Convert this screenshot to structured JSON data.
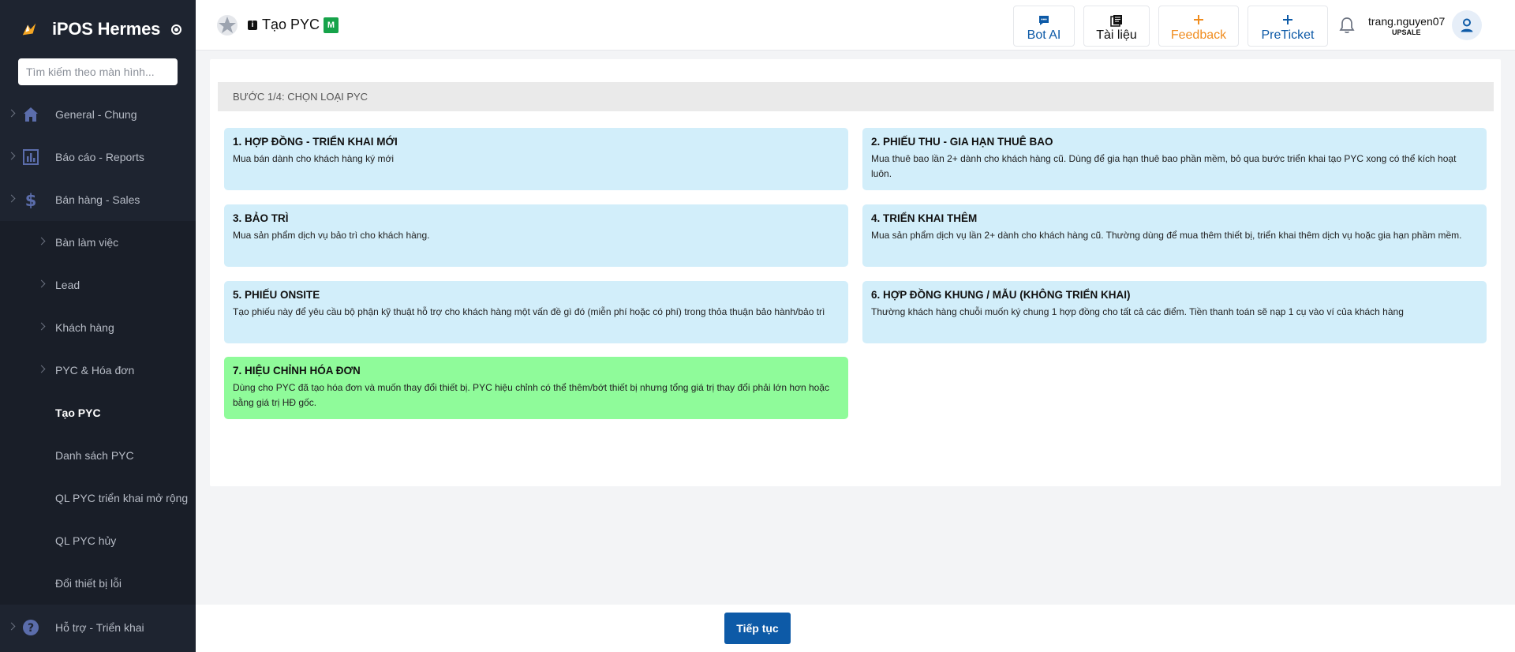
{
  "app": {
    "name": "iPOS Hermes",
    "search_placeholder": "Tìm kiếm theo màn hình..."
  },
  "sidebar": {
    "items": [
      {
        "label": "General - Chung",
        "icon": "home-icon"
      },
      {
        "label": "Báo cáo - Reports",
        "icon": "bar-chart-icon"
      },
      {
        "label": "Bán hàng - Sales",
        "icon": "dollar-icon"
      },
      {
        "label": "Bàn làm việc"
      },
      {
        "label": "Lead"
      },
      {
        "label": "Khách hàng"
      },
      {
        "label": "PYC & Hóa đơn"
      },
      {
        "label": "Tạo PYC"
      },
      {
        "label": "Danh sách PYC"
      },
      {
        "label": "QL PYC triển khai mở rộng"
      },
      {
        "label": "QL PYC hủy"
      },
      {
        "label": "Đổi thiết bị lỗi"
      },
      {
        "label": "Hỗ trợ - Triển khai",
        "icon": "help-icon"
      }
    ],
    "active_item": "Tạo PYC"
  },
  "header": {
    "info_glyph": "i",
    "title": "Tạo PYC",
    "badge": "M",
    "buttons": [
      {
        "label": "Bot AI",
        "icon": "chat-icon",
        "color": "#0d5aa7"
      },
      {
        "label": "Tài liệu",
        "icon": "book-icon",
        "color": "#111111"
      },
      {
        "label": "Feedback",
        "icon": "plus-icon",
        "color": "#f08c1e"
      },
      {
        "label": "PreTicket",
        "icon": "plus-icon",
        "color": "#0d5aa7"
      }
    ],
    "user": {
      "name": "trang.nguyen07",
      "role": "UPSALE"
    }
  },
  "main": {
    "step_label": "BƯỚC 1/4: CHỌN LOẠI PYC",
    "options": [
      {
        "title": "1. HỢP ĐỒNG - TRIỂN KHAI MỚI",
        "desc": "Mua bán dành cho khách hàng ký mới",
        "color": "#d2eefa"
      },
      {
        "title": "2. PHIẾU THU - GIA HẠN THUÊ BAO",
        "desc": "Mua thuê bao lần 2+ dành cho khách hàng cũ. Dùng để gia hạn thuê bao phần mềm, bỏ qua bước triển khai tạo PYC xong có thể kích hoạt luôn.",
        "color": "#d2eefa"
      },
      {
        "title": "3. BẢO TRÌ",
        "desc": "Mua sản phẩm dịch vụ bảo trì cho khách hàng.",
        "color": "#d2eefa"
      },
      {
        "title": "4. TRIỂN KHAI THÊM",
        "desc": "Mua sản phẩm dịch vụ lần 2+ dành cho khách hàng cũ. Thường dùng để mua thêm thiết bị, triển khai thêm dịch vụ hoặc gia hạn phầm mềm.",
        "color": "#d2eefa"
      },
      {
        "title": "5. PHIẾU ONSITE",
        "desc": "Tạo phiếu này để yêu cầu bộ phận kỹ thuật hỗ trợ cho khách hàng một vấn đề gì đó (miễn phí hoặc có phí) trong thỏa thuận bảo hành/bảo trì",
        "color": "#d2eefa"
      },
      {
        "title": "6. HỢP ĐỒNG KHUNG / MẪU (KHÔNG TRIỂN KHAI)",
        "desc": "Thường khách hàng chuỗi muốn ký chung 1 hợp đồng cho tất cả các điểm. Tiền thanh toán sẽ nạp 1 cụ vào ví của khách hàng",
        "color": "#d2eefa"
      },
      {
        "title": "7. HIỆU CHỈNH HÓA ĐƠN",
        "desc": "Dùng cho PYC đã tạo hóa đơn và muốn thay đổi thiết bị. PYC hiệu chỉnh có thể thêm/bớt thiết bị nhưng tổng giá trị thay đổi phải lớn hơn hoặc bằng giá trị HĐ gốc.",
        "color": "#8ffb9a"
      }
    ]
  },
  "footer": {
    "continue_label": "Tiếp tục"
  }
}
